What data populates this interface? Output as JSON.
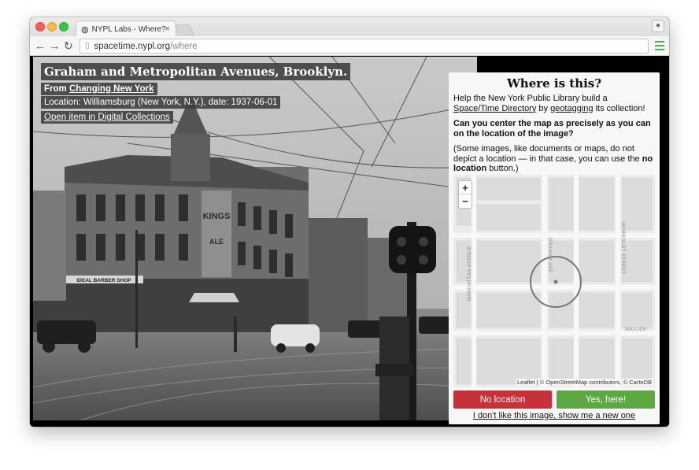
{
  "browser": {
    "tab_title": "NYPL Labs - Where?",
    "tab_close": "×",
    "url_host": "spacetime.nypl.org",
    "url_path": "/where",
    "nav": {
      "back": "←",
      "forward": "→",
      "reload": "↻"
    }
  },
  "photo": {
    "title": "Graham and Metropolitan Avenues, Brooklyn.",
    "from_prefix": "From ",
    "collection": "Changing New York",
    "location_line": "Location: Williamsburg (New York, N.Y.), date: 1937-06-01",
    "open_link": "Open item in Digital Collections",
    "signs": {
      "kings_line1": "KINGS",
      "kings_line2": "ALE",
      "shop": "IDEAL BARBER SHOP"
    }
  },
  "panel": {
    "title": "Where is this?",
    "intro_pre": "Help the New York Public Library build a ",
    "intro_link1": "Space/Time Directory",
    "intro_mid": " by ",
    "intro_link2": "geotagging",
    "intro_post": " its collection!",
    "question": "Can you center the map as precisely as you can on the location of the image?",
    "note_pre": "(Some images, like documents or maps, do not depict a location — in that case, you can use the ",
    "note_bold": "no location",
    "note_post": " button.)",
    "zoom_in": "+",
    "zoom_out": "−",
    "street_labels": [
      "MANHATTAN AVENUE",
      "GRAHAM AVE",
      "HUMBOLDT STREET",
      "MAUJER"
    ],
    "attribution": "Leaflet | © OpenStreetMap contributors, © CartoDB",
    "no_location_button": "No location",
    "yes_button": "Yes, here!",
    "skip_link": "I don't like this image, show me a new one"
  },
  "colors": {
    "no_button": "#c7323a",
    "yes_button": "#5ea843",
    "menu_icon": "#4cae4c"
  },
  "icons": [
    "globe-tab-icon",
    "page-icon",
    "profile-icon",
    "hamburger-menu-icon",
    "back-arrow-icon",
    "forward-arrow-icon",
    "reload-icon",
    "crosshair-circle-icon"
  ]
}
